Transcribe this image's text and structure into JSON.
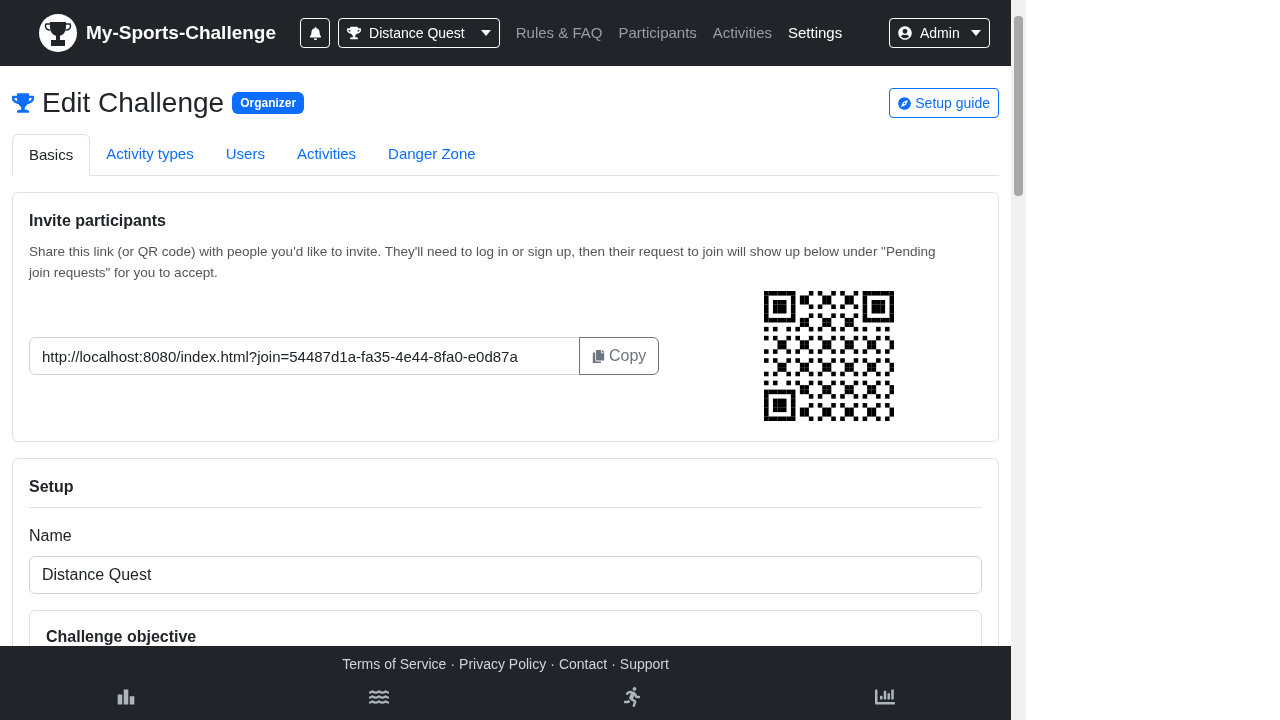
{
  "navbar": {
    "brand": "My-Sports-Challenge",
    "challenge_menu": "Distance Quest",
    "links": [
      {
        "label": "Rules & FAQ",
        "selected": false
      },
      {
        "label": "Participants",
        "selected": false
      },
      {
        "label": "Activities",
        "selected": false
      },
      {
        "label": "Settings",
        "selected": true
      }
    ],
    "user_menu": "Admin"
  },
  "page": {
    "title": "Edit Challenge",
    "badge": "Organizer",
    "guide_button": "Setup guide"
  },
  "tabs": [
    {
      "label": "Basics",
      "selected": true
    },
    {
      "label": "Activity types",
      "selected": false
    },
    {
      "label": "Users",
      "selected": false
    },
    {
      "label": "Activities",
      "selected": false
    },
    {
      "label": "Danger Zone",
      "selected": false
    }
  ],
  "invite": {
    "heading": "Invite participants",
    "text": "Share this link (or QR code) with people you'd like to invite. They'll need to log in or sign up, then their request to join will show up below under \"Pending join requests\" for you to accept.",
    "link": "http://localhost:8080/index.html?join=54487d1a-fa35-4e44-8fa0-e0d87a",
    "copy_button": "Copy"
  },
  "setup": {
    "heading": "Setup",
    "name_label": "Name",
    "name_value": "Distance Quest",
    "objective_heading": "Challenge objective"
  },
  "footer": {
    "links": [
      "Terms of Service",
      "Privacy Policy",
      "Contact",
      "Support"
    ],
    "separator": "·"
  },
  "bottom_nav": [
    {
      "kind": "podium"
    },
    {
      "kind": "waves"
    },
    {
      "kind": "runner"
    },
    {
      "kind": "chart"
    }
  ]
}
